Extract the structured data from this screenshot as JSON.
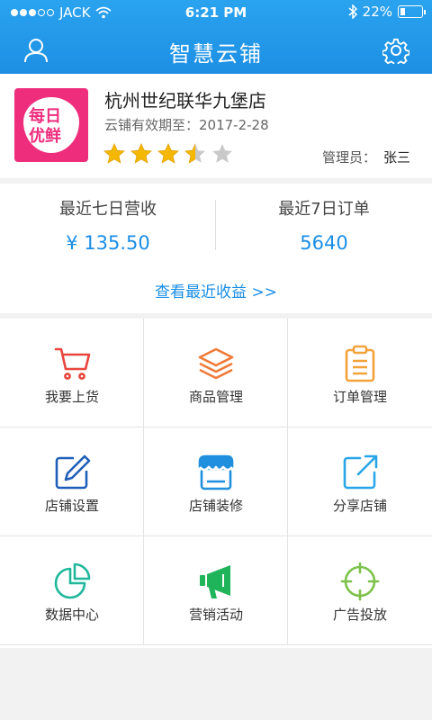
{
  "status_bar": {
    "carrier": "JACK",
    "time": "6:21 PM",
    "battery": "22%",
    "battery_level": 0.22
  },
  "header": {
    "title": "智慧云铺",
    "user_icon": "user-icon",
    "settings_icon": "gear-icon",
    "accent": "#1f94e6"
  },
  "store": {
    "logo_line1": "每日",
    "logo_line2": "优鲜",
    "name": "杭州世纪联华九堡店",
    "expiry": "云铺有效期至：2017-2-28",
    "rating": 3.5,
    "rating_max": 5,
    "manager_label": "管理员：",
    "manager_name": "张三"
  },
  "stats": {
    "revenue_label": "最近七日营收",
    "revenue_value": "¥ 135.50",
    "orders_label": "最近7日订单",
    "orders_value": "5640",
    "view_link": "查看最近收益 >>"
  },
  "menu": [
    {
      "label": "我要上货",
      "icon": "cart-icon",
      "color": "#e8453c"
    },
    {
      "label": "商品管理",
      "icon": "layers-icon",
      "color": "#f07a38"
    },
    {
      "label": "订单管理",
      "icon": "clipboard-icon",
      "color": "#f3a23a"
    },
    {
      "label": "店铺设置",
      "icon": "edit-icon",
      "color": "#1f5fb8"
    },
    {
      "label": "店铺装修",
      "icon": "storefront-icon",
      "color": "#1f8fde"
    },
    {
      "label": "分享店铺",
      "icon": "share-icon",
      "color": "#29a6e8"
    },
    {
      "label": "数据中心",
      "icon": "pie-chart-icon",
      "color": "#1fb89a"
    },
    {
      "label": "营销活动",
      "icon": "megaphone-icon",
      "color": "#1fb45a"
    },
    {
      "label": "广告投放",
      "icon": "target-icon",
      "color": "#7cc24a"
    }
  ]
}
